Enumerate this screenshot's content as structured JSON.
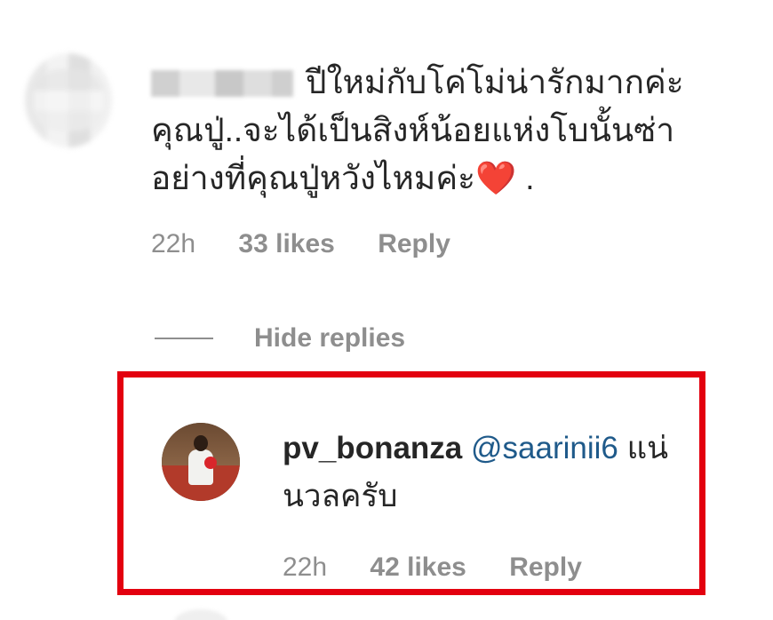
{
  "top_comment": {
    "text": "ปีใหม่กับโค่โม่น่ารักมากค่ะ คุณปู่..จะได้เป็นสิงห์น้อยแห่งโบนั้นซ่า อย่างที่คุณปู่หวังไหมค่ะ❤️ .",
    "time": "22h",
    "likes": "33 likes",
    "reply": "Reply"
  },
  "hide_replies": {
    "label": "Hide replies"
  },
  "reply": {
    "username": "pv_bonanza",
    "mention": "@saarinii6",
    "text": "แน่นวลครับ",
    "time": "22h",
    "likes": "42 likes",
    "reply": "Reply"
  },
  "colors": {
    "highlight_border": "#e3000f",
    "meta_gray": "#8e8e8e",
    "mention_blue": "#1f5a8a",
    "text": "#262626"
  }
}
